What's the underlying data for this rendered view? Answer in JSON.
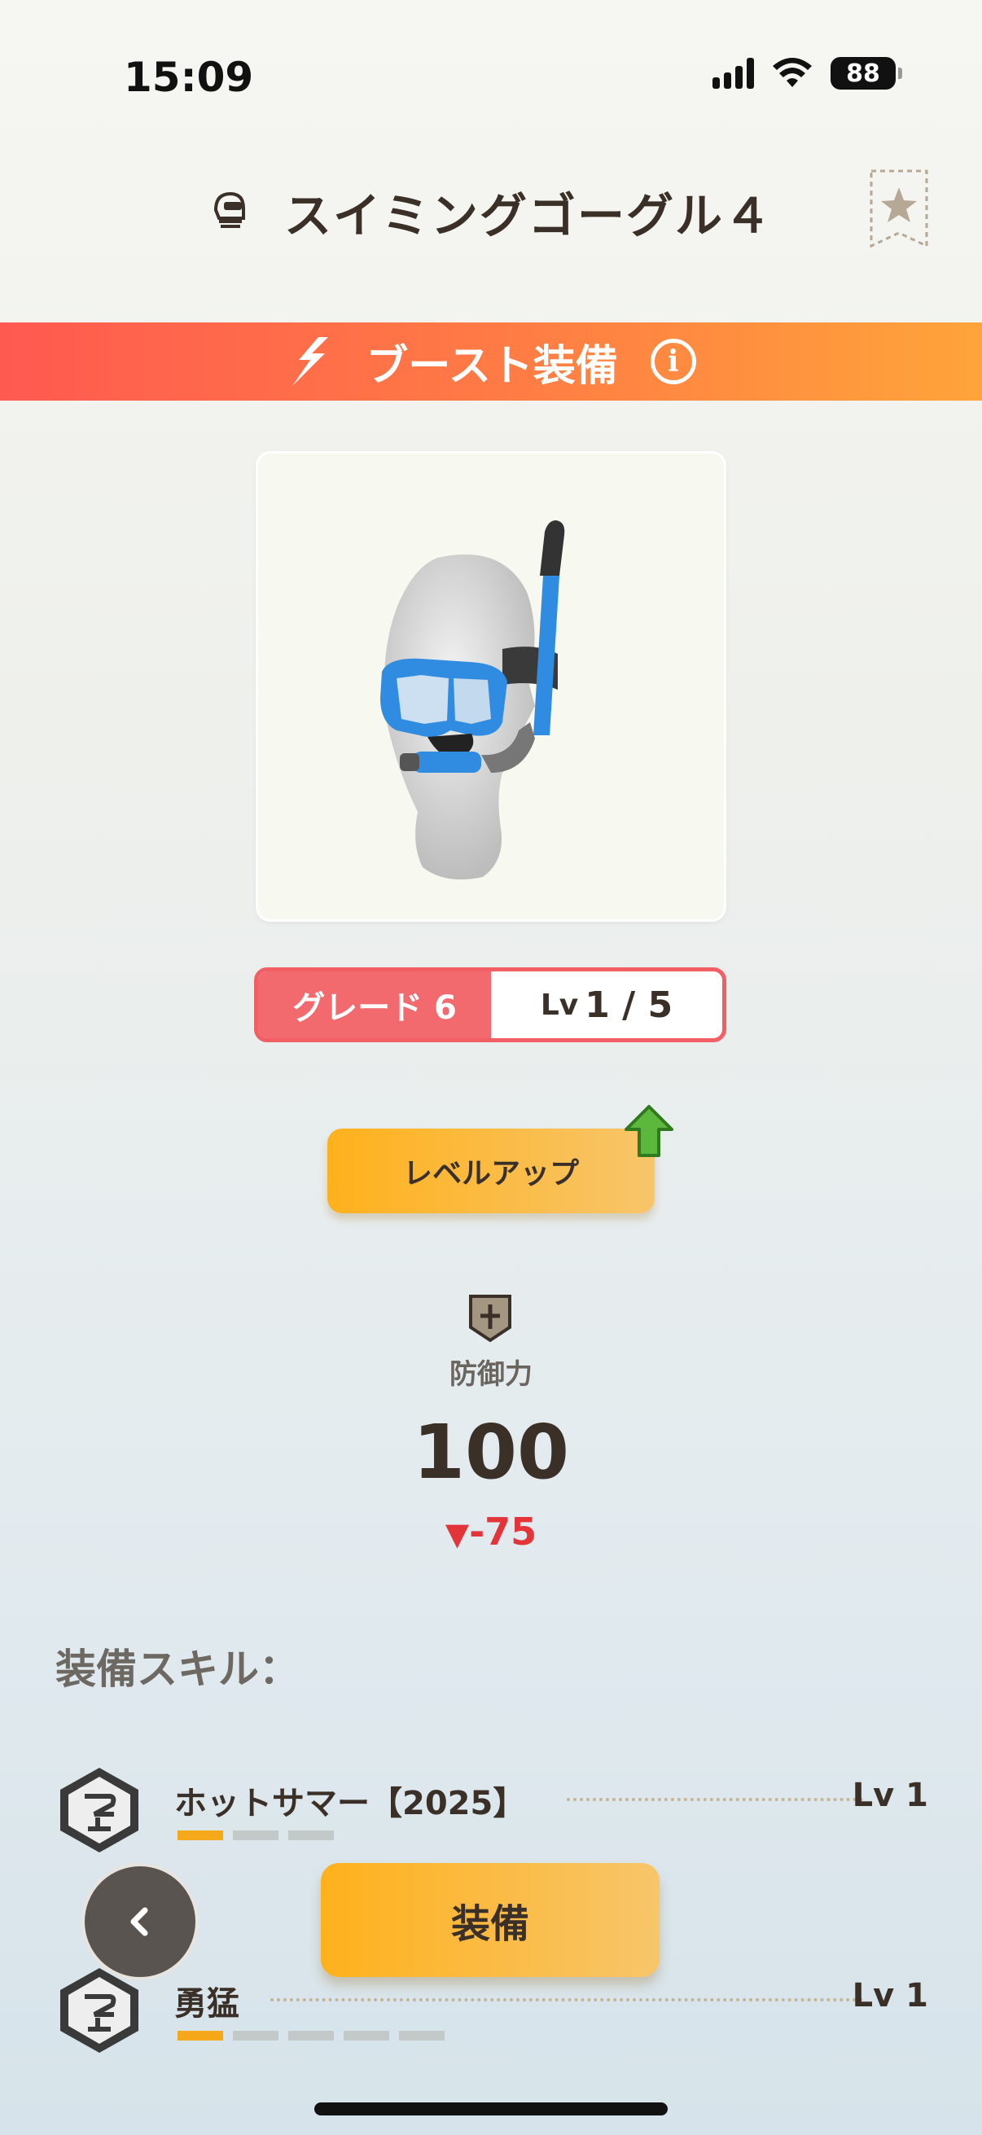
{
  "status_bar": {
    "time": "15:09",
    "battery": "88"
  },
  "header": {
    "title": "スイミングゴーグル４",
    "title_icon": "helmet-icon",
    "bookmark_icon": "star-bookmark-icon"
  },
  "banner": {
    "label": "ブースト装備",
    "icon": "boost-icon",
    "info_icon": "info-icon",
    "colors": [
      "#ff5a50",
      "#ffa43a"
    ]
  },
  "item": {
    "image": "snorkel-mask-on-mannequin",
    "accent_color": "#3a97e0"
  },
  "grade": {
    "grade_label": "グレード 6",
    "level_prefix": "Lv",
    "level_value": "1 / 5"
  },
  "level_up": {
    "label": "レベルアップ",
    "icon": "green-up-arrow-icon"
  },
  "stat": {
    "icon": "shield-icon",
    "label": "防御力",
    "value": "100",
    "diff_symbol": "▼",
    "diff": "-75",
    "diff_color": "#e3343a"
  },
  "skills": {
    "header": "装備スキル：",
    "items": [
      {
        "name": "ホットサマー【2025】",
        "level": "Lv 1",
        "filled": 1,
        "total": 3
      },
      {
        "name": "勇猛",
        "level": "Lv 1",
        "filled": 1,
        "total": 5
      }
    ]
  },
  "actions": {
    "equip_label": "装備",
    "back_icon": "chevron-left-icon"
  }
}
